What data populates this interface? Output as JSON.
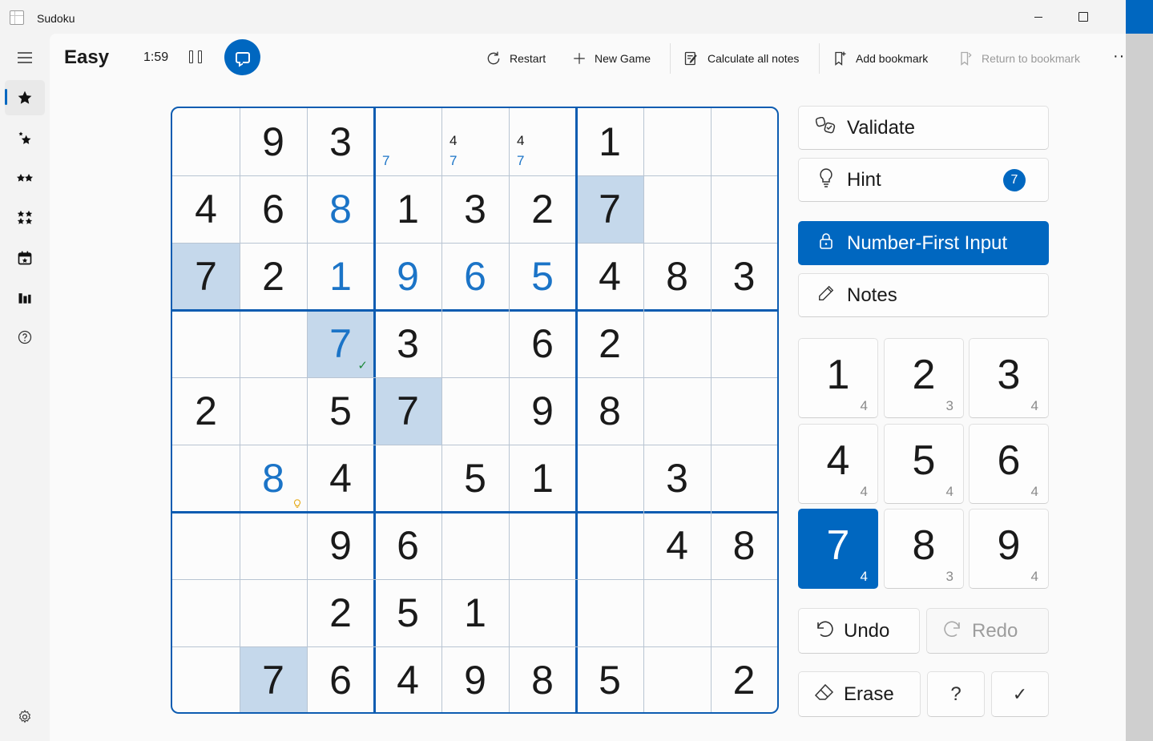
{
  "window": {
    "title": "Sudoku",
    "minimize": "—",
    "maximize": "☐"
  },
  "header": {
    "difficulty": "Easy",
    "timer": "1:59",
    "toolbar": {
      "restart": "Restart",
      "new_game": "New Game",
      "calculate_notes": "Calculate all notes",
      "add_bookmark": "Add bookmark",
      "return_bookmark": "Return to bookmark",
      "more": "··"
    }
  },
  "nav": {
    "items": [
      {
        "name": "menu-icon",
        "glyph": "☰"
      },
      {
        "name": "star-icon",
        "glyph": "★"
      },
      {
        "name": "stars-small-icon",
        "glyph": "✦"
      },
      {
        "name": "stars-medium-icon",
        "glyph": "✶"
      },
      {
        "name": "stars-large-icon",
        "glyph": "✷"
      },
      {
        "name": "calendar-icon",
        "glyph": "▦"
      },
      {
        "name": "stats-icon",
        "glyph": "▮"
      },
      {
        "name": "help-icon",
        "glyph": "?"
      }
    ],
    "settings_icon": "⚙"
  },
  "board": {
    "cells": [
      [
        "",
        "9",
        "3",
        "",
        "",
        "",
        "1",
        "",
        ""
      ],
      [
        "4",
        "6",
        "8",
        "1",
        "3",
        "2",
        "7",
        "",
        ""
      ],
      [
        "7",
        "2",
        "1",
        "9",
        "6",
        "5",
        "4",
        "8",
        "3"
      ],
      [
        "",
        "",
        "7",
        "3",
        "",
        "6",
        "2",
        "",
        ""
      ],
      [
        "2",
        "",
        "5",
        "7",
        "",
        "9",
        "8",
        "",
        ""
      ],
      [
        "",
        "8",
        "4",
        "",
        "5",
        "1",
        "",
        "3",
        ""
      ],
      [
        "",
        "",
        "9",
        "6",
        "",
        "",
        "",
        "4",
        "8"
      ],
      [
        "",
        "",
        "2",
        "5",
        "1",
        "",
        "",
        "",
        ""
      ],
      [
        "",
        "7",
        "6",
        "4",
        "9",
        "8",
        "5",
        "",
        "2"
      ]
    ],
    "user_entered": [
      [
        1,
        2
      ],
      [
        2,
        2
      ],
      [
        2,
        3
      ],
      [
        2,
        4
      ],
      [
        2,
        5
      ],
      [
        3,
        2
      ],
      [
        5,
        1
      ]
    ],
    "highlighted": [
      [
        1,
        6
      ],
      [
        2,
        0
      ],
      [
        3,
        2
      ],
      [
        4,
        3
      ],
      [
        8,
        1
      ]
    ],
    "notes": [
      {
        "r": 0,
        "c": 3,
        "items": [
          {
            "t": "7",
            "blue": true,
            "pos": "bl"
          }
        ]
      },
      {
        "r": 0,
        "c": 4,
        "items": [
          {
            "t": "4",
            "blue": false,
            "pos": "ml"
          },
          {
            "t": "7",
            "blue": true,
            "pos": "bl"
          }
        ]
      },
      {
        "r": 0,
        "c": 5,
        "items": [
          {
            "t": "4",
            "blue": false,
            "pos": "ml"
          },
          {
            "t": "7",
            "blue": true,
            "pos": "bl"
          }
        ]
      }
    ],
    "validated_cell": [
      3,
      2
    ],
    "hint_cell": [
      5,
      1
    ]
  },
  "panel": {
    "validate": "Validate",
    "hint": "Hint",
    "hint_count": "7",
    "number_first": "Number-First Input",
    "notes": "Notes",
    "numbers": [
      {
        "n": "1",
        "count": "4"
      },
      {
        "n": "2",
        "count": "3"
      },
      {
        "n": "3",
        "count": "4"
      },
      {
        "n": "4",
        "count": "4"
      },
      {
        "n": "5",
        "count": "4"
      },
      {
        "n": "6",
        "count": "4"
      },
      {
        "n": "7",
        "count": "4"
      },
      {
        "n": "8",
        "count": "3"
      },
      {
        "n": "9",
        "count": "4"
      }
    ],
    "selected_number": "7",
    "undo": "Undo",
    "redo": "Redo",
    "erase": "Erase",
    "question": "?",
    "confirm": "✓"
  },
  "colors": {
    "accent": "#0067c0",
    "highlight": "#c5d8eb",
    "user_digit": "#1b74c7"
  }
}
